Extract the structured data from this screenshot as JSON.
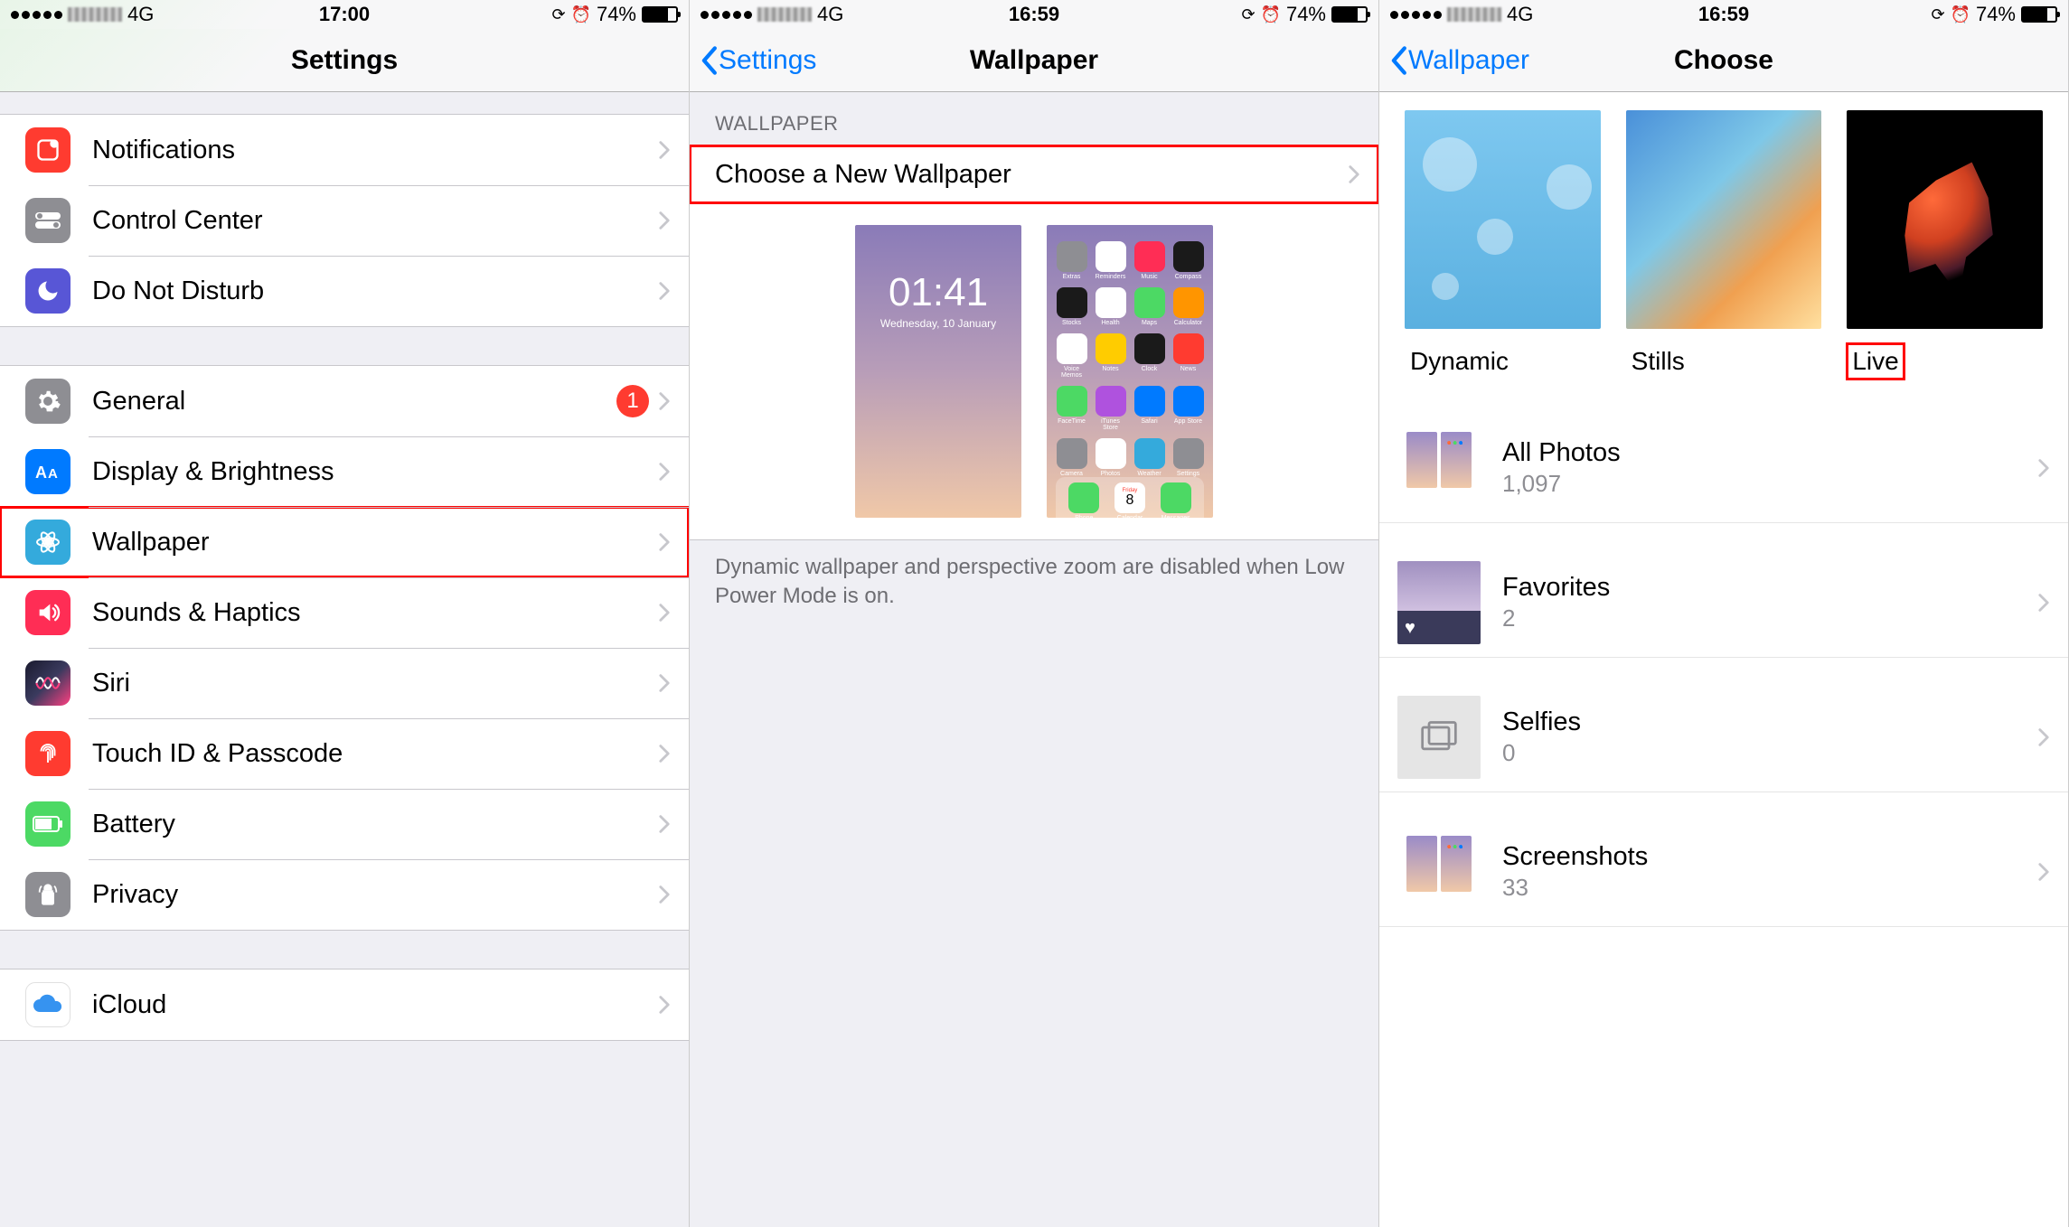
{
  "statusbar": {
    "carrier_tech": "4G",
    "battery_pct": "74%",
    "screen1_time": "17:00",
    "screen2_time": "16:59",
    "screen3_time": "16:59"
  },
  "screen1": {
    "nav_title": "Settings",
    "groups": [
      {
        "rows": [
          {
            "id": "notifications",
            "label": "Notifications",
            "icon_name": "notifications-icon"
          },
          {
            "id": "control-center",
            "label": "Control Center",
            "icon_name": "control-center-icon"
          },
          {
            "id": "do-not-disturb",
            "label": "Do Not Disturb",
            "icon_name": "dnd-icon"
          }
        ]
      },
      {
        "rows": [
          {
            "id": "general",
            "label": "General",
            "icon_name": "general-icon",
            "badge": "1"
          },
          {
            "id": "display",
            "label": "Display & Brightness",
            "icon_name": "display-icon"
          },
          {
            "id": "wallpaper",
            "label": "Wallpaper",
            "icon_name": "wallpaper-icon",
            "highlight": true
          },
          {
            "id": "sounds",
            "label": "Sounds & Haptics",
            "icon_name": "sounds-icon"
          },
          {
            "id": "siri",
            "label": "Siri",
            "icon_name": "siri-icon"
          },
          {
            "id": "touchid",
            "label": "Touch ID & Passcode",
            "icon_name": "touchid-icon"
          },
          {
            "id": "battery",
            "label": "Battery",
            "icon_name": "battery-icon"
          },
          {
            "id": "privacy",
            "label": "Privacy",
            "icon_name": "privacy-icon"
          }
        ]
      },
      {
        "rows": [
          {
            "id": "icloud",
            "label": "iCloud",
            "icon_name": "icloud-icon"
          }
        ]
      }
    ]
  },
  "screen2": {
    "nav_back": "Settings",
    "nav_title": "Wallpaper",
    "section_header": "WALLPAPER",
    "choose_label": "Choose a New Wallpaper",
    "lock_preview": {
      "time": "01:41",
      "date": "Wednesday, 10 January"
    },
    "home_apps": [
      "Extras",
      "Reminders",
      "Music",
      "Compass",
      "Stocks",
      "Health",
      "Maps",
      "Calculator",
      "Voice Memos",
      "Notes",
      "Clock",
      "News",
      "FaceTime",
      "iTunes Store",
      "Safari",
      "App Store",
      "Camera",
      "Photos",
      "Weather",
      "Settings"
    ],
    "dock_apps": [
      "Phone",
      "Calendar",
      "Messages"
    ],
    "dock_day": "8",
    "dock_weekday": "Friday",
    "footer": "Dynamic wallpaper and perspective zoom are disabled when Low Power Mode is on."
  },
  "screen3": {
    "nav_back": "Wallpaper",
    "nav_title": "Choose",
    "categories": [
      {
        "id": "dynamic",
        "label": "Dynamic"
      },
      {
        "id": "stills",
        "label": "Stills"
      },
      {
        "id": "live",
        "label": "Live",
        "highlight": true
      }
    ],
    "albums": [
      {
        "id": "all-photos",
        "title": "All Photos",
        "count": "1,097",
        "thumb": "twophones"
      },
      {
        "id": "favorites",
        "title": "Favorites",
        "count": "2",
        "thumb": "fav"
      },
      {
        "id": "selfies",
        "title": "Selfies",
        "count": "0",
        "thumb": "selfies"
      },
      {
        "id": "screenshots",
        "title": "Screenshots",
        "count": "33",
        "thumb": "twophones"
      }
    ]
  },
  "app_colors": {
    "Extras": "#8e8e93",
    "Reminders": "#fff",
    "Music": "#ff2d55",
    "Compass": "#1a1a1a",
    "Stocks": "#1a1a1a",
    "Health": "#fff",
    "Maps": "#4cd964",
    "Calculator": "#ff9500",
    "Voice Memos": "#fff",
    "Notes": "#ffcc00",
    "Clock": "#1a1a1a",
    "News": "#ff3b30",
    "FaceTime": "#4cd964",
    "iTunes Store": "#af52de",
    "Safari": "#007aff",
    "App Store": "#007aff",
    "Camera": "#8e8e93",
    "Photos": "#fff",
    "Weather": "#34aadc",
    "Settings": "#8e8e93",
    "Phone": "#4cd964",
    "Calendar": "#fff",
    "Messages": "#4cd964"
  }
}
